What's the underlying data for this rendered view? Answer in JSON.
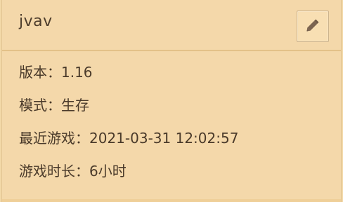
{
  "header": {
    "title": "jvav",
    "edit_icon": "pencil-icon"
  },
  "details": {
    "version_label": "版本：",
    "version_value": "1.16",
    "mode_label": "模式：",
    "mode_value": "生存",
    "last_played_label": "最近游戏：",
    "last_played_value": "2021-03-31 12:02:57",
    "play_time_label": "游戏时长：",
    "play_time_value": "6小时"
  },
  "colors": {
    "background": "#f4d8aa",
    "divider": "#e3c188",
    "text": "#4a3a2a",
    "icon": "#7b6450"
  }
}
